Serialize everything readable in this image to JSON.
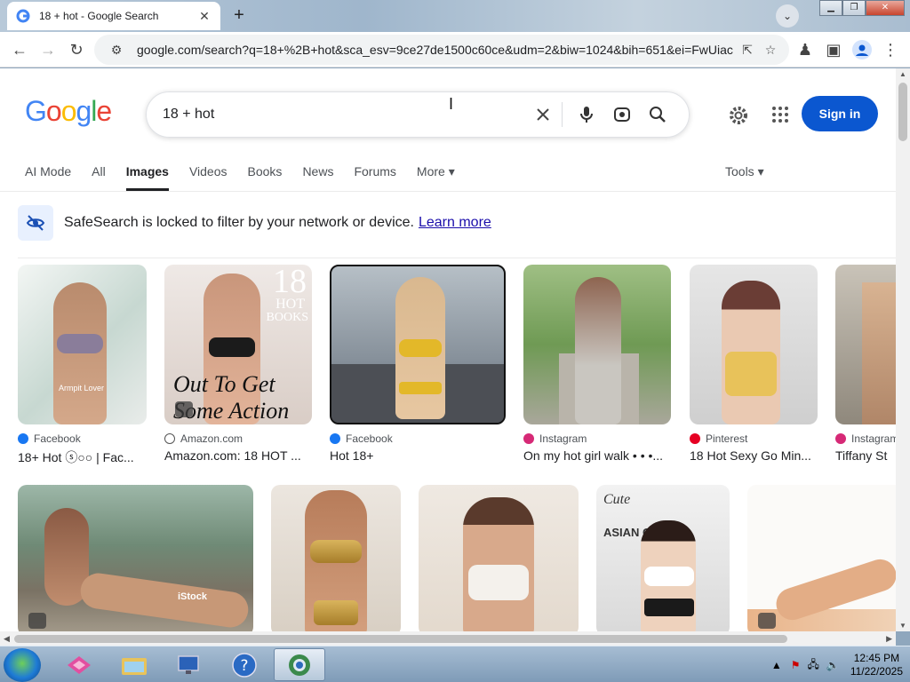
{
  "tab": {
    "title": "18 + hot - Google Search",
    "close": "✕"
  },
  "toolbar": {
    "url": "google.com/search?q=18+%2B+hot&sca_esv=9ce27de1500c60ce&udm=2&biw=1024&bih=651&ei=FwUiac..."
  },
  "search": {
    "query": "18 + hot"
  },
  "header": {
    "signin": "Sign in"
  },
  "tabs": [
    "AI Mode",
    "All",
    "Images",
    "Videos",
    "Books",
    "News",
    "Forums",
    "More ▾"
  ],
  "tools": "Tools ▾",
  "safesearch": {
    "text": "SafeSearch is locked to filter by your network or device.",
    "link": "Learn more"
  },
  "results_row1": [
    {
      "source": "Facebook",
      "caption": "18+ Hot ⓢ○○ | Fac...",
      "color": "#1877f2"
    },
    {
      "source": "Amazon.com",
      "caption": "Amazon.com: 18 HOT ...",
      "color": "#222"
    },
    {
      "source": "Facebook",
      "caption": "Hot 18+",
      "color": "#1877f2"
    },
    {
      "source": "Instagram",
      "caption": "On my hot girl walk • • •...",
      "color": "#d62976"
    },
    {
      "source": "Pinterest",
      "caption": "18 Hot Sexy Go Min...",
      "color": "#e60023"
    },
    {
      "source": "Instagram",
      "caption": "Tiffany St",
      "color": "#d62976"
    }
  ],
  "book_text": {
    "num": "18",
    "hot": "HOT",
    "books": "BOOKS",
    "line1": "Out To Get",
    "line2": "Some Action"
  },
  "watermarks": {
    "armpit": "Armpit Lover",
    "istock": "iStock",
    "cute": "Cute",
    "asian": "ASIAN GIRLS"
  },
  "taskbar": {
    "time": "12:45 PM",
    "date": "11/22/2025"
  },
  "colors": {
    "google_blue": "#4285f4",
    "google_red": "#ea4335",
    "google_yellow": "#fbbc05",
    "google_green": "#34a853",
    "signin": "#0b57d0"
  }
}
